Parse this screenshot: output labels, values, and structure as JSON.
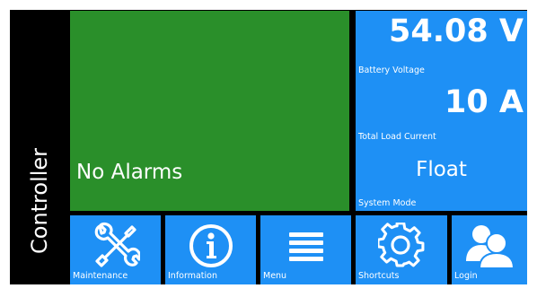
{
  "sidebar": {
    "title": "Controller"
  },
  "alarm_panel": {
    "status_text": "No Alarms",
    "color": "#2a8f2a"
  },
  "status_panel": {
    "color": "#1e90f5",
    "battery_voltage": {
      "value": "54.08 V",
      "label": "Battery Voltage"
    },
    "total_load_current": {
      "value": "10 A",
      "label": "Total Load Current"
    },
    "system_mode": {
      "value": "Float",
      "label": "System Mode"
    }
  },
  "nav": {
    "tiles": [
      {
        "label": "Maintenance",
        "icon": "wrench-screwdriver-icon"
      },
      {
        "label": "Information",
        "icon": "info-icon"
      },
      {
        "label": "Menu",
        "icon": "menu-lines-icon"
      },
      {
        "label": "Shortcuts",
        "icon": "gear-icon"
      },
      {
        "label": "Login",
        "icon": "users-icon"
      }
    ]
  }
}
